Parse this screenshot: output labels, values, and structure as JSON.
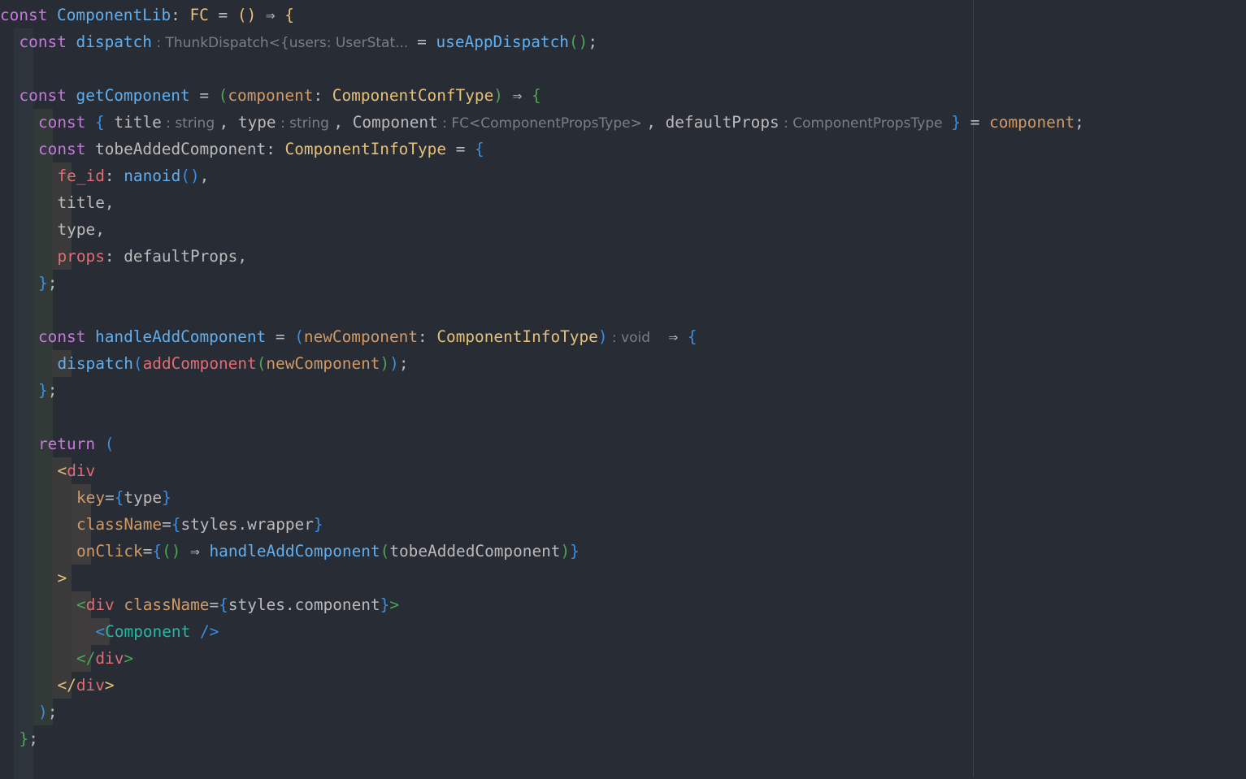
{
  "editor": {
    "language": "tsx",
    "lines": [
      {
        "guides": [],
        "tokens": [
          {
            "t": "const ",
            "c": "k"
          },
          {
            "t": "ComponentLib",
            "c": "f"
          },
          {
            "t": ": ",
            "c": "op"
          },
          {
            "t": "FC",
            "c": "t"
          },
          {
            "t": " = ",
            "c": "op"
          },
          {
            "t": "()",
            "c": "b1"
          },
          {
            "t": " ⇒ ",
            "c": "op"
          },
          {
            "t": "{",
            "c": "b1"
          }
        ]
      },
      {
        "guides": [
          "g0"
        ],
        "tokens": [
          {
            "t": "const ",
            "c": "k"
          },
          {
            "t": "dispatch",
            "c": "f"
          },
          {
            "t": " : ThunkDispatch<{users: UserStat...  ",
            "c": "hint"
          },
          {
            "t": "= ",
            "c": "op"
          },
          {
            "t": "useAppDispatch",
            "c": "f"
          },
          {
            "t": "()",
            "c": "b2"
          },
          {
            "t": ";",
            "c": "op"
          }
        ]
      },
      {
        "guides": [
          "g0"
        ],
        "tokens": []
      },
      {
        "guides": [
          "g0"
        ],
        "tokens": [
          {
            "t": "const ",
            "c": "k"
          },
          {
            "t": "getComponent",
            "c": "f"
          },
          {
            "t": " = ",
            "c": "op"
          },
          {
            "t": "(",
            "c": "b2"
          },
          {
            "t": "component",
            "c": "p"
          },
          {
            "t": ": ",
            "c": "op"
          },
          {
            "t": "ComponentConfType",
            "c": "t"
          },
          {
            "t": ")",
            "c": "b2"
          },
          {
            "t": " ⇒ ",
            "c": "op"
          },
          {
            "t": "{",
            "c": "b2"
          }
        ]
      },
      {
        "guides": [
          "g0",
          "g1"
        ],
        "tokens": [
          {
            "t": "const ",
            "c": "k"
          },
          {
            "t": "{ ",
            "c": "b3"
          },
          {
            "t": "title",
            "c": "w"
          },
          {
            "t": " : string ",
            "c": "hint"
          },
          {
            "t": ", ",
            "c": "op"
          },
          {
            "t": "type",
            "c": "w"
          },
          {
            "t": " : string ",
            "c": "hint"
          },
          {
            "t": ", ",
            "c": "op"
          },
          {
            "t": "Component",
            "c": "w"
          },
          {
            "t": " : FC<ComponentPropsType> ",
            "c": "hint"
          },
          {
            "t": ", ",
            "c": "op"
          },
          {
            "t": "defaultProps",
            "c": "w"
          },
          {
            "t": " : ComponentPropsType  ",
            "c": "hint"
          },
          {
            "t": "}",
            "c": "b3"
          },
          {
            "t": " = ",
            "c": "op"
          },
          {
            "t": "component",
            "c": "p"
          },
          {
            "t": ";",
            "c": "op"
          }
        ]
      },
      {
        "guides": [
          "g0",
          "g1"
        ],
        "tokens": [
          {
            "t": "const ",
            "c": "k"
          },
          {
            "t": "tobeAddedComponent",
            "c": "w"
          },
          {
            "t": ": ",
            "c": "op"
          },
          {
            "t": "ComponentInfoType",
            "c": "t"
          },
          {
            "t": " = ",
            "c": "op"
          },
          {
            "t": "{",
            "c": "b3"
          }
        ]
      },
      {
        "guides": [
          "g0",
          "g1",
          "g2"
        ],
        "tokens": [
          {
            "t": "fe_id",
            "c": "r"
          },
          {
            "t": ": ",
            "c": "op"
          },
          {
            "t": "nanoid",
            "c": "f"
          },
          {
            "t": "()",
            "c": "b3"
          },
          {
            "t": ",",
            "c": "op"
          }
        ]
      },
      {
        "guides": [
          "g0",
          "g1",
          "g2"
        ],
        "tokens": [
          {
            "t": "title",
            "c": "w"
          },
          {
            "t": ",",
            "c": "op"
          }
        ]
      },
      {
        "guides": [
          "g0",
          "g1",
          "g2"
        ],
        "tokens": [
          {
            "t": "type",
            "c": "w"
          },
          {
            "t": ",",
            "c": "op"
          }
        ]
      },
      {
        "guides": [
          "g0",
          "g1",
          "g2"
        ],
        "tokens": [
          {
            "t": "props",
            "c": "r"
          },
          {
            "t": ": ",
            "c": "op"
          },
          {
            "t": "defaultProps",
            "c": "w"
          },
          {
            "t": ",",
            "c": "op"
          }
        ]
      },
      {
        "guides": [
          "g0",
          "g1"
        ],
        "tokens": [
          {
            "t": "}",
            "c": "b3"
          },
          {
            "t": ";",
            "c": "op"
          }
        ]
      },
      {
        "guides": [
          "g0",
          "g1"
        ],
        "tokens": []
      },
      {
        "guides": [
          "g0",
          "g1"
        ],
        "tokens": [
          {
            "t": "const ",
            "c": "k"
          },
          {
            "t": "handleAddComponent",
            "c": "f"
          },
          {
            "t": " = ",
            "c": "op"
          },
          {
            "t": "(",
            "c": "b3"
          },
          {
            "t": "newComponent",
            "c": "p"
          },
          {
            "t": ": ",
            "c": "op"
          },
          {
            "t": "ComponentInfoType",
            "c": "t"
          },
          {
            "t": ")",
            "c": "b3"
          },
          {
            "t": " : void  ",
            "c": "hint"
          },
          {
            "t": " ⇒ ",
            "c": "op"
          },
          {
            "t": "{",
            "c": "b3"
          }
        ]
      },
      {
        "guides": [
          "g0",
          "g1",
          "g2"
        ],
        "tokens": [
          {
            "t": "dispatch",
            "c": "f"
          },
          {
            "t": "(",
            "c": "b3"
          },
          {
            "t": "addComponent",
            "c": "r"
          },
          {
            "t": "(",
            "c": "b2"
          },
          {
            "t": "newComponent",
            "c": "p"
          },
          {
            "t": ")",
            "c": "b2"
          },
          {
            "t": ")",
            "c": "b3"
          },
          {
            "t": ";",
            "c": "op"
          }
        ]
      },
      {
        "guides": [
          "g0",
          "g1"
        ],
        "tokens": [
          {
            "t": "}",
            "c": "b3"
          },
          {
            "t": ";",
            "c": "op"
          }
        ]
      },
      {
        "guides": [
          "g0",
          "g1"
        ],
        "tokens": []
      },
      {
        "guides": [
          "g0",
          "g1"
        ],
        "tokens": [
          {
            "t": "return ",
            "c": "k"
          },
          {
            "t": "(",
            "c": "b3"
          }
        ]
      },
      {
        "guides": [
          "g0",
          "g1",
          "g2"
        ],
        "tokens": [
          {
            "t": "<",
            "c": "b1"
          },
          {
            "t": "div",
            "c": "tag"
          }
        ]
      },
      {
        "guides": [
          "g0",
          "g1",
          "g2",
          "g3"
        ],
        "tokens": [
          {
            "t": "key",
            "c": "a"
          },
          {
            "t": "=",
            "c": "op"
          },
          {
            "t": "{",
            "c": "b3"
          },
          {
            "t": "type",
            "c": "w"
          },
          {
            "t": "}",
            "c": "b3"
          }
        ]
      },
      {
        "guides": [
          "g0",
          "g1",
          "g2",
          "g3"
        ],
        "tokens": [
          {
            "t": "className",
            "c": "a"
          },
          {
            "t": "=",
            "c": "op"
          },
          {
            "t": "{",
            "c": "b3"
          },
          {
            "t": "styles.wrapper",
            "c": "w"
          },
          {
            "t": "}",
            "c": "b3"
          }
        ]
      },
      {
        "guides": [
          "g0",
          "g1",
          "g2",
          "g3"
        ],
        "tokens": [
          {
            "t": "onClick",
            "c": "a"
          },
          {
            "t": "=",
            "c": "op"
          },
          {
            "t": "{",
            "c": "b3"
          },
          {
            "t": "()",
            "c": "b2"
          },
          {
            "t": " ⇒ ",
            "c": "op"
          },
          {
            "t": "handleAddComponent",
            "c": "f"
          },
          {
            "t": "(",
            "c": "b2"
          },
          {
            "t": "tobeAddedComponent",
            "c": "w"
          },
          {
            "t": ")",
            "c": "b2"
          },
          {
            "t": "}",
            "c": "b3"
          }
        ]
      },
      {
        "guides": [
          "g0",
          "g1",
          "g2"
        ],
        "tokens": [
          {
            "t": ">",
            "c": "b1"
          }
        ]
      },
      {
        "guides": [
          "g0",
          "g1",
          "g2",
          "g3"
        ],
        "tokens": [
          {
            "t": "<",
            "c": "b2"
          },
          {
            "t": "div ",
            "c": "tag"
          },
          {
            "t": "className",
            "c": "a"
          },
          {
            "t": "=",
            "c": "op"
          },
          {
            "t": "{",
            "c": "b3"
          },
          {
            "t": "styles.component",
            "c": "w"
          },
          {
            "t": "}",
            "c": "b3"
          },
          {
            "t": ">",
            "c": "b2"
          }
        ]
      },
      {
        "guides": [
          "g0",
          "g1",
          "g2",
          "g3",
          "g3"
        ],
        "tokens": [
          {
            "t": "<",
            "c": "b3"
          },
          {
            "t": "Component ",
            "c": "cmp"
          },
          {
            "t": "/>",
            "c": "b3"
          }
        ]
      },
      {
        "guides": [
          "g0",
          "g1",
          "g2",
          "g3"
        ],
        "tokens": [
          {
            "t": "</",
            "c": "b2"
          },
          {
            "t": "div",
            "c": "tag"
          },
          {
            "t": ">",
            "c": "b2"
          }
        ]
      },
      {
        "guides": [
          "g0",
          "g1",
          "g2"
        ],
        "tokens": [
          {
            "t": "</",
            "c": "b1"
          },
          {
            "t": "div",
            "c": "tag"
          },
          {
            "t": ">",
            "c": "b1"
          }
        ]
      },
      {
        "guides": [
          "g0",
          "g1"
        ],
        "tokens": [
          {
            "t": ")",
            "c": "b3"
          },
          {
            "t": ";",
            "c": "op"
          }
        ]
      },
      {
        "guides": [
          "g0"
        ],
        "tokens": [
          {
            "t": "}",
            "c": "b2"
          },
          {
            "t": ";",
            "c": "op"
          }
        ]
      },
      {
        "guides": [
          "g0"
        ],
        "tokens": []
      }
    ]
  }
}
